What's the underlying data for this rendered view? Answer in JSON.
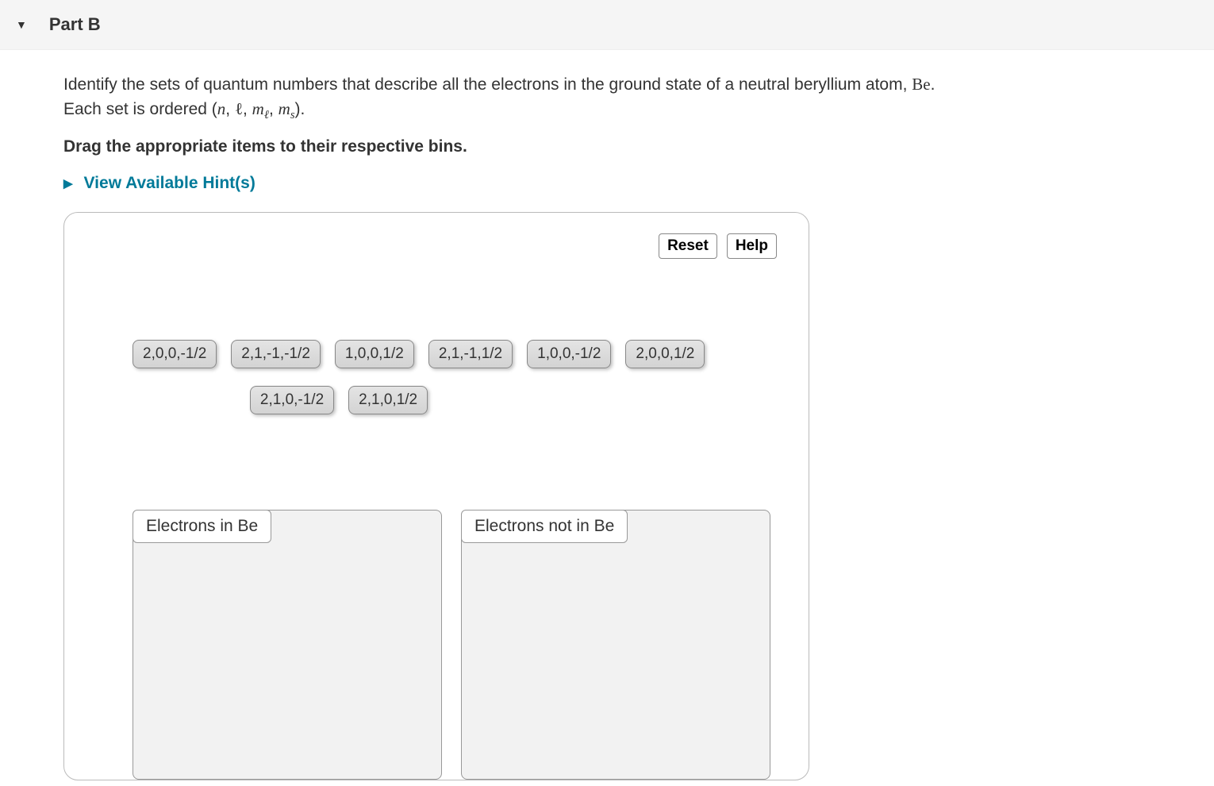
{
  "header": {
    "label": "Part B"
  },
  "prompt": {
    "line1_prefix": "Identify the sets of quantum numbers that describe all the electrons in the ground state of a neutral beryllium atom, ",
    "be_symbol": "Be",
    "line1_suffix": ".",
    "line2_prefix": "Each set is ordered (",
    "n": "n",
    "comma1": ", ",
    "l": "ℓ",
    "comma2": ", ",
    "m1": "m",
    "m1_sub": "ℓ",
    "comma3": ", ",
    "m2": "m",
    "m2_sub": "s",
    "line2_suffix": ")."
  },
  "instruction": "Drag the appropriate items to their respective bins.",
  "hints_label": "View Available Hint(s)",
  "controls": {
    "reset": "Reset",
    "help": "Help"
  },
  "chips": [
    "2,0,0,-1/2",
    "2,1,-1,-1/2",
    "1,0,0,1/2",
    "2,1,-1,1/2",
    "1,0,0,-1/2",
    "2,0,0,1/2",
    "2,1,0,-1/2",
    "2,1,0,1/2"
  ],
  "bins": [
    {
      "label": "Electrons in Be"
    },
    {
      "label": "Electrons not in Be"
    }
  ]
}
